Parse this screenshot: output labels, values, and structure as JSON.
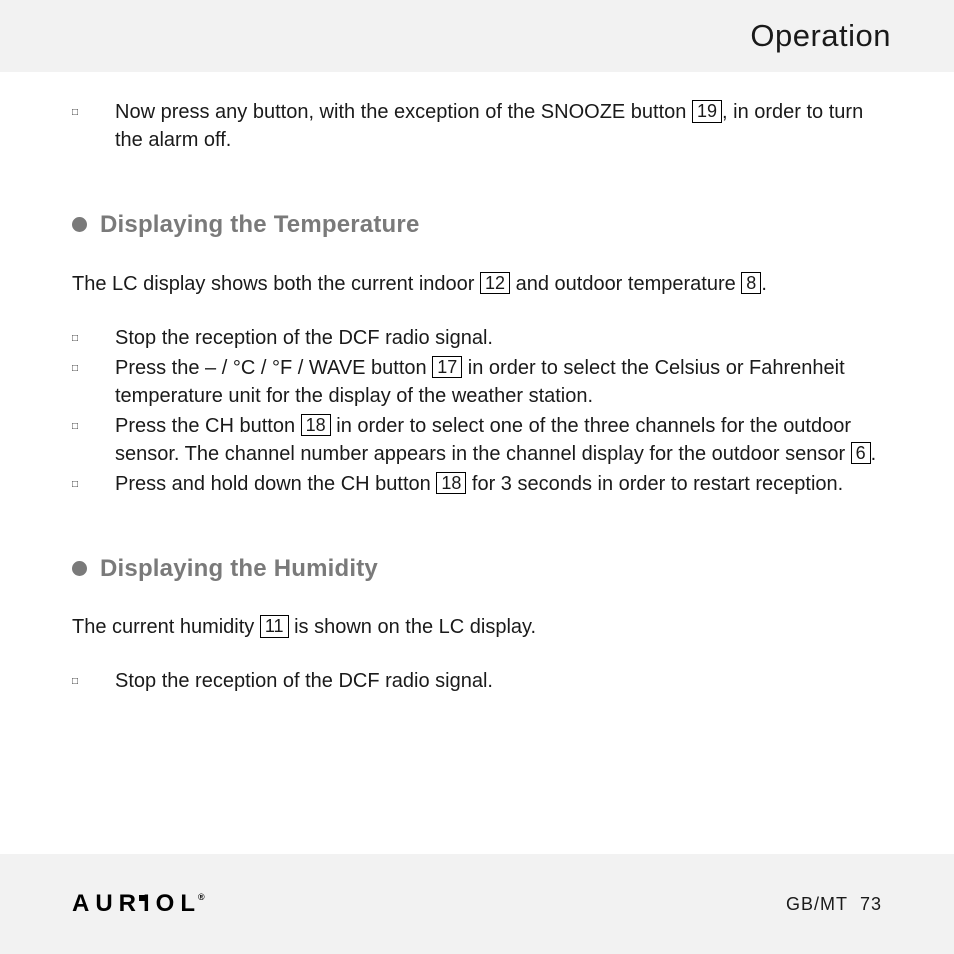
{
  "header": {
    "title": "Operation"
  },
  "intro": {
    "item1_pre": "Now press any button, with the exception of the SNOOZE button ",
    "item1_ref": "19",
    "item1_post": ", in order to turn the alarm off."
  },
  "section_temp": {
    "heading": "Displaying the Temperature",
    "para_pre": "The LC display shows both the current indoor ",
    "para_ref1": "12",
    "para_mid": " and outdoor temperature ",
    "para_ref2": "8",
    "para_post": ".",
    "items": {
      "i1": "Stop the reception of the DCF radio signal.",
      "i2_pre": "Press the – / °C / °F / WAVE button ",
      "i2_ref": "17",
      "i2_post": " in order to select the Celsius or Fahrenheit temperature unit for the display of the weather station.",
      "i3_pre": "Press the CH button ",
      "i3_ref1": "18",
      "i3_mid": " in order to select one of the three channels for the outdoor sensor. The channel number appears in the channel display for the outdoor sensor ",
      "i3_ref2": "6",
      "i3_post": ".",
      "i4_pre": "Press and hold down the CH button ",
      "i4_ref": "18",
      "i4_post": " for 3 seconds in order to restart reception."
    }
  },
  "section_hum": {
    "heading": "Displaying the Humidity",
    "para_pre": "The current humidity ",
    "para_ref": "11",
    "para_post": " is shown on the LC display.",
    "items": {
      "i1": "Stop the reception of the DCF radio signal."
    }
  },
  "footer": {
    "brand": "AURIOL",
    "region": "GB/MT",
    "page": "73"
  },
  "marker": "□"
}
